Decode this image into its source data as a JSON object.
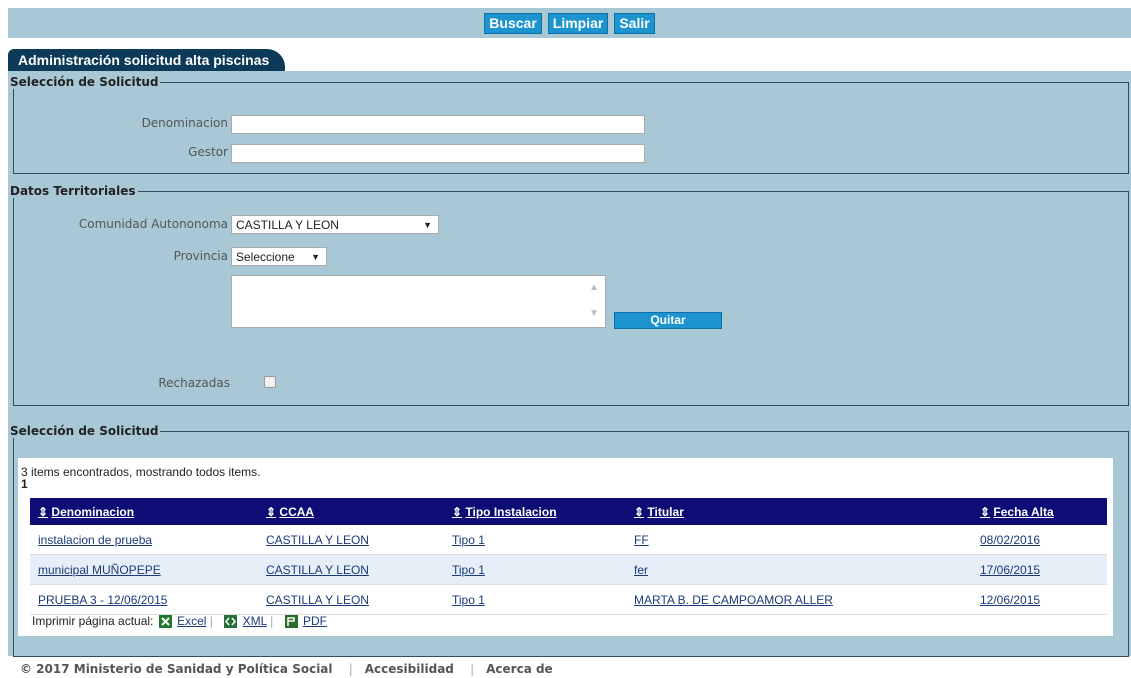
{
  "toolbar": {
    "buscar": "Buscar",
    "limpiar": "Limpiar",
    "salir": "Salir"
  },
  "tab": {
    "title": "Administración solicitud alta piscinas"
  },
  "seleccion": {
    "legend": "Selección de Solicitud",
    "denominacion_label": "Denominacion",
    "denominacion_value": "",
    "gestor_label": "Gestor",
    "gestor_value": ""
  },
  "territorial": {
    "legend": "Datos Territoriales",
    "ccaa_label": "Comunidad Autononoma",
    "ccaa_value": "CASTILLA Y LEON",
    "provincia_label": "Provincia",
    "provincia_value": "Seleccione",
    "quitar_label": "Quitar",
    "rechazadas_label": "Rechazadas",
    "rechazadas_checked": false
  },
  "results": {
    "legend": "Selección de Solicitud",
    "info": "3 items encontrados, mostrando todos items.",
    "page": "1",
    "columns": [
      "Denominacion",
      "CCAA",
      "Tipo Instalacion",
      "Titular",
      "Fecha Alta"
    ],
    "sort_glyph": "⇕",
    "rows": [
      [
        "instalacion de prueba",
        "CASTILLA Y LEON",
        "Tipo 1",
        "FF",
        "08/02/2016"
      ],
      [
        "municipal MUÑOPEPE",
        "CASTILLA Y LEON",
        "Tipo 1",
        "fer",
        "17/06/2015"
      ],
      [
        "PRUEBA 3 - 12/06/2015",
        "CASTILLA Y LEON",
        "Tipo 1",
        "MARTA B. DE CAMPOAMOR ALLER",
        "12/06/2015"
      ]
    ]
  },
  "export": {
    "prefix": "Imprimir página actual:",
    "excel": "Excel",
    "xml": "XML",
    "pdf": "PDF",
    "icons": [
      "excel-icon",
      "xml-icon",
      "pdf-icon"
    ]
  },
  "footer": {
    "copyright": "© 2017 Ministerio de Sanidad y Política Social",
    "accesibilidad": "Accesibilidad",
    "acerca": "Acerca de"
  },
  "colors": {
    "panel_bg": "#a9c8d6",
    "button_blue": "#1b94cf",
    "table_header": "#0d0d75",
    "tab_bg": "#0d3a58"
  }
}
